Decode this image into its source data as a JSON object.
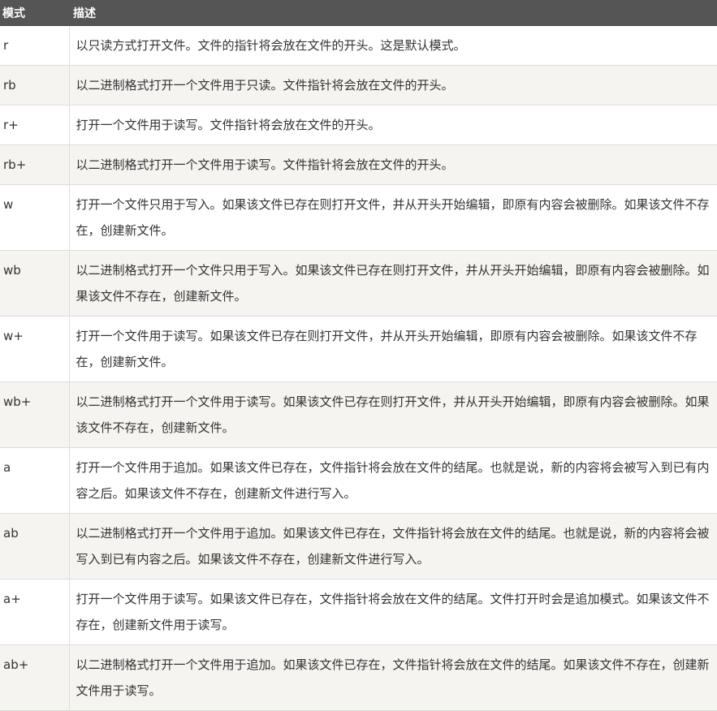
{
  "table": {
    "headers": {
      "mode": "模式",
      "description": "描述"
    },
    "rows": [
      {
        "mode": "r",
        "description": "以只读方式打开文件。文件的指针将会放在文件的开头。这是默认模式。"
      },
      {
        "mode": "rb",
        "description": "以二进制格式打开一个文件用于只读。文件指针将会放在文件的开头。"
      },
      {
        "mode": "r+",
        "description": "打开一个文件用于读写。文件指针将会放在文件的开头。"
      },
      {
        "mode": "rb+",
        "description": "以二进制格式打开一个文件用于读写。文件指针将会放在文件的开头。"
      },
      {
        "mode": "w",
        "description": "打开一个文件只用于写入。如果该文件已存在则打开文件，并从开头开始编辑，即原有内容会被删除。如果该文件不存在，创建新文件。"
      },
      {
        "mode": "wb",
        "description": "以二进制格式打开一个文件只用于写入。如果该文件已存在则打开文件，并从开头开始编辑，即原有内容会被删除。如果该文件不存在，创建新文件。"
      },
      {
        "mode": "w+",
        "description": "打开一个文件用于读写。如果该文件已存在则打开文件，并从开头开始编辑，即原有内容会被删除。如果该文件不存在，创建新文件。"
      },
      {
        "mode": "wb+",
        "description": "以二进制格式打开一个文件用于读写。如果该文件已存在则打开文件，并从开头开始编辑，即原有内容会被删除。如果该文件不存在，创建新文件。"
      },
      {
        "mode": "a",
        "description": "打开一个文件用于追加。如果该文件已存在，文件指针将会放在文件的结尾。也就是说，新的内容将会被写入到已有内容之后。如果该文件不存在，创建新文件进行写入。"
      },
      {
        "mode": "ab",
        "description": "以二进制格式打开一个文件用于追加。如果该文件已存在，文件指针将会放在文件的结尾。也就是说，新的内容将会被写入到已有内容之后。如果该文件不存在，创建新文件进行写入。"
      },
      {
        "mode": "a+",
        "description": "打开一个文件用于读写。如果该文件已存在，文件指针将会放在文件的结尾。文件打开时会是追加模式。如果该文件不存在，创建新文件用于读写。"
      },
      {
        "mode": "ab+",
        "description": "以二进制格式打开一个文件用于追加。如果该文件已存在，文件指针将会放在文件的结尾。如果该文件不存在，创建新文件用于读写。"
      }
    ]
  },
  "colors": {
    "header_bg": "#555555",
    "header_text": "#ffffff",
    "row_alt_bg": "#f6f4f0",
    "border": "#dddddd",
    "text": "#333333"
  }
}
